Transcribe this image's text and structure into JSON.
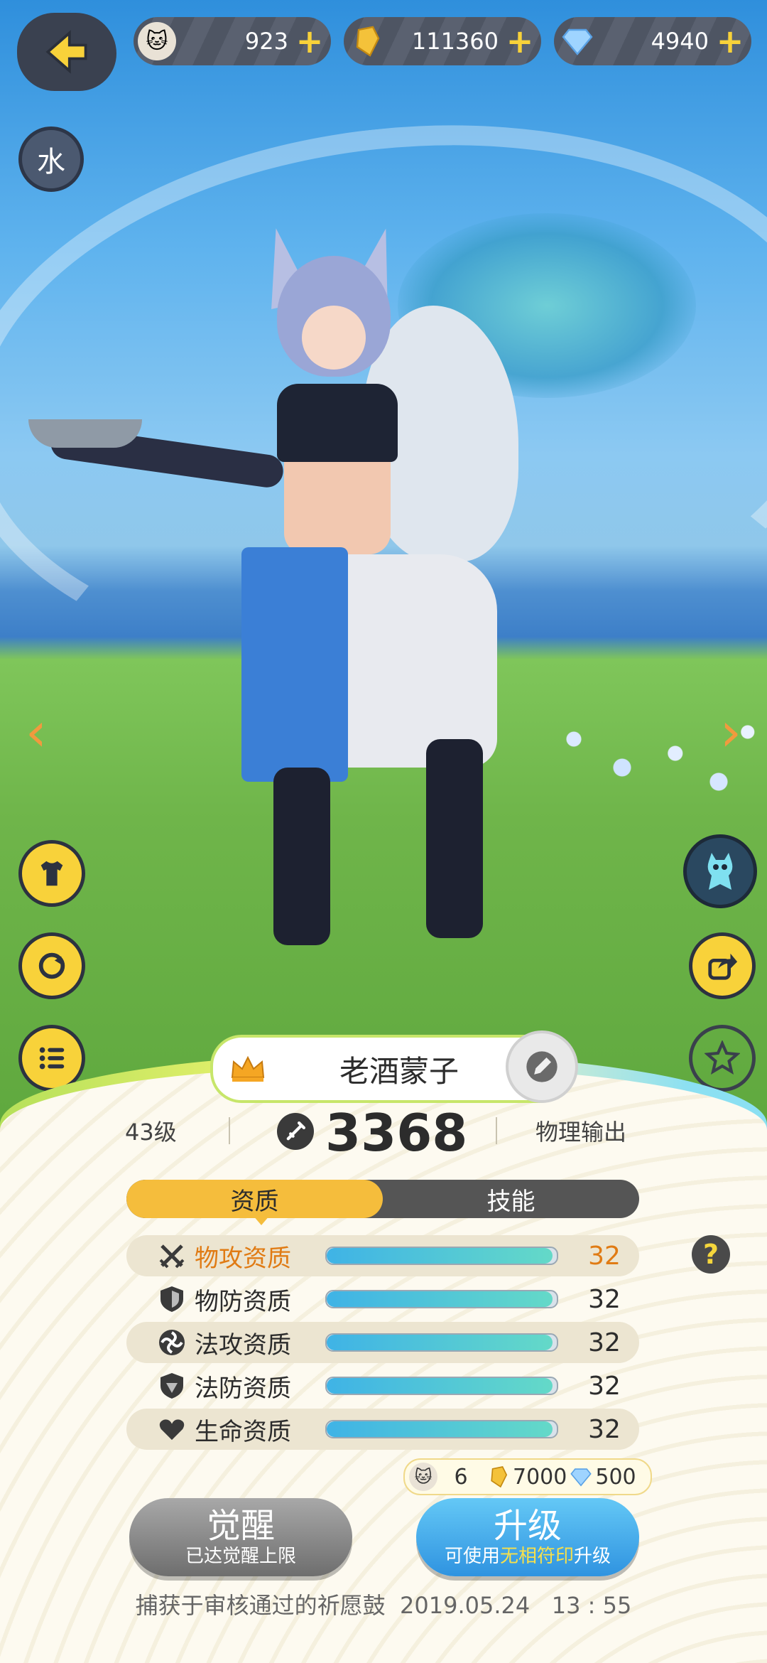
{
  "currencies": [
    {
      "icon": "creature-coin-icon",
      "value": "923"
    },
    {
      "icon": "gold-crystal-icon",
      "value": "111360"
    },
    {
      "icon": "diamond-icon",
      "value": "4940"
    }
  ],
  "element_badge": "水",
  "character": {
    "name": "老酒蒙子",
    "level": "43级",
    "power": "3368",
    "attack_type": "物理输出"
  },
  "tabs": [
    {
      "label": "资质",
      "active": true
    },
    {
      "label": "技能",
      "active": false
    }
  ],
  "attributes": [
    {
      "icon": "physical-attack-icon",
      "label": "物攻资质",
      "value": "32",
      "fill": 0.98,
      "highlight": true
    },
    {
      "icon": "physical-defense-icon",
      "label": "物防资质",
      "value": "32",
      "fill": 0.98,
      "highlight": false
    },
    {
      "icon": "magic-attack-icon",
      "label": "法攻资质",
      "value": "32",
      "fill": 0.98,
      "highlight": false
    },
    {
      "icon": "magic-defense-icon",
      "label": "法防资质",
      "value": "32",
      "fill": 0.98,
      "highlight": false
    },
    {
      "icon": "heart-icon",
      "label": "生命资质",
      "value": "32",
      "fill": 0.98,
      "highlight": false
    }
  ],
  "cost": {
    "creature": "6",
    "gold": "7000",
    "diamond": "500"
  },
  "awaken": {
    "label": "觉醒",
    "sub": "已达觉醒上限"
  },
  "upgrade": {
    "label": "升级",
    "sub_prefix": "可使用",
    "sub_highlight": "无相符印",
    "sub_suffix": "升级"
  },
  "footer": "捕获于审核通过的祈愿鼓  2019.05.24   13 : 55",
  "colors": {
    "accent": "#f5bd3c",
    "highlight": "#e07b14",
    "upgrade": "#2f93e0",
    "plus": "#f8d23a"
  }
}
